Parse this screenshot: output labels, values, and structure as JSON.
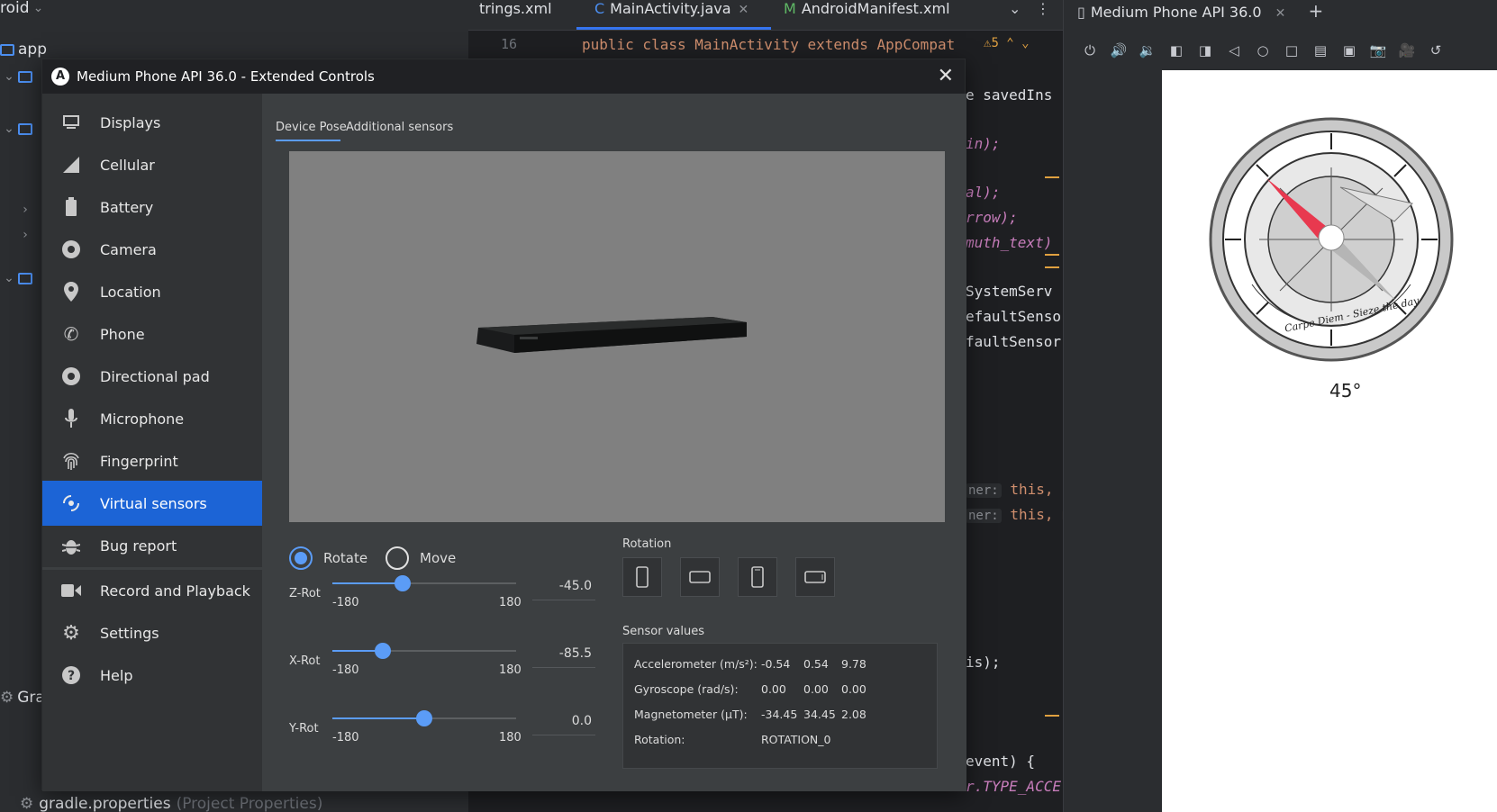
{
  "ide": {
    "project_title": "roid",
    "project_root": "app",
    "project_items": [
      "Gra",
      "gradle.properties"
    ],
    "gradle_properties_hint": "(Project Properties)",
    "tabs": [
      {
        "label": "trings.xml"
      },
      {
        "label": "MainActivity.java",
        "icon": "C"
      },
      {
        "label": "AndroidManifest.xml",
        "icon": "M"
      }
    ],
    "line_number": "16",
    "code": {
      "line16": "public class MainActivity extends AppCompat",
      "warnings": "5",
      "fragments": [
        "e savedIns",
        "in);",
        "al);",
        "rrow);",
        "muth_text)",
        "SystemServ",
        "efaultSenso",
        "faultSensor",
        "this, a",
        "this, m",
        "is);",
        "event) {",
        "r.TYPE_ACCE"
      ],
      "param_hint": "ner:"
    }
  },
  "emulator": {
    "tab_label": "Medium Phone API 36.0",
    "compass_text": "Carpe Diem - Sieze the day",
    "heading": "45°"
  },
  "dialog": {
    "title": "Medium Phone API 36.0 - Extended Controls",
    "nav": [
      {
        "label": "Displays",
        "icon": "display-icon"
      },
      {
        "label": "Cellular",
        "icon": "cellular-icon"
      },
      {
        "label": "Battery",
        "icon": "battery-icon"
      },
      {
        "label": "Camera",
        "icon": "camera-icon"
      },
      {
        "label": "Location",
        "icon": "location-pin-icon"
      },
      {
        "label": "Phone",
        "icon": "phone-icon"
      },
      {
        "label": "Directional pad",
        "icon": "dpad-icon"
      },
      {
        "label": "Microphone",
        "icon": "microphone-icon"
      },
      {
        "label": "Fingerprint",
        "icon": "fingerprint-icon"
      },
      {
        "label": "Virtual sensors",
        "icon": "virtual-sensors-icon",
        "active": true
      },
      {
        "label": "Bug report",
        "icon": "bug-icon"
      },
      {
        "label": "Record and Playback",
        "icon": "video-camera-icon"
      },
      {
        "label": "Settings",
        "icon": "gear-icon"
      },
      {
        "label": "Help",
        "icon": "help-icon"
      }
    ],
    "subtabs": [
      "Device Pose",
      "Additional sensors"
    ],
    "mode": {
      "rotate": "Rotate",
      "move": "Move",
      "selected": "Rotate"
    },
    "sliders": [
      {
        "label": "Z-Rot",
        "min": "-180",
        "max": "180",
        "value": "-45.0"
      },
      {
        "label": "X-Rot",
        "min": "-180",
        "max": "180",
        "value": "-85.5"
      },
      {
        "label": "Y-Rot",
        "min": "-180",
        "max": "180",
        "value": "0.0"
      }
    ],
    "rotation_label": "Rotation",
    "sensor_values_label": "Sensor values",
    "sensors": [
      {
        "name": "Accelerometer (m/s²):",
        "values": [
          "-0.54",
          "0.54",
          "9.78"
        ]
      },
      {
        "name": "Gyroscope (rad/s):",
        "values": [
          "0.00",
          "0.00",
          "0.00"
        ]
      },
      {
        "name": "Magnetometer (µT):",
        "values": [
          "-34.45",
          "34.45",
          "2.08"
        ]
      },
      {
        "name": "Rotation:",
        "values": [
          "ROTATION_0"
        ]
      }
    ]
  },
  "colors": {
    "accent": "#1c64d6",
    "slider": "#5b9cf6",
    "dialog_bg": "#3c3f41"
  }
}
